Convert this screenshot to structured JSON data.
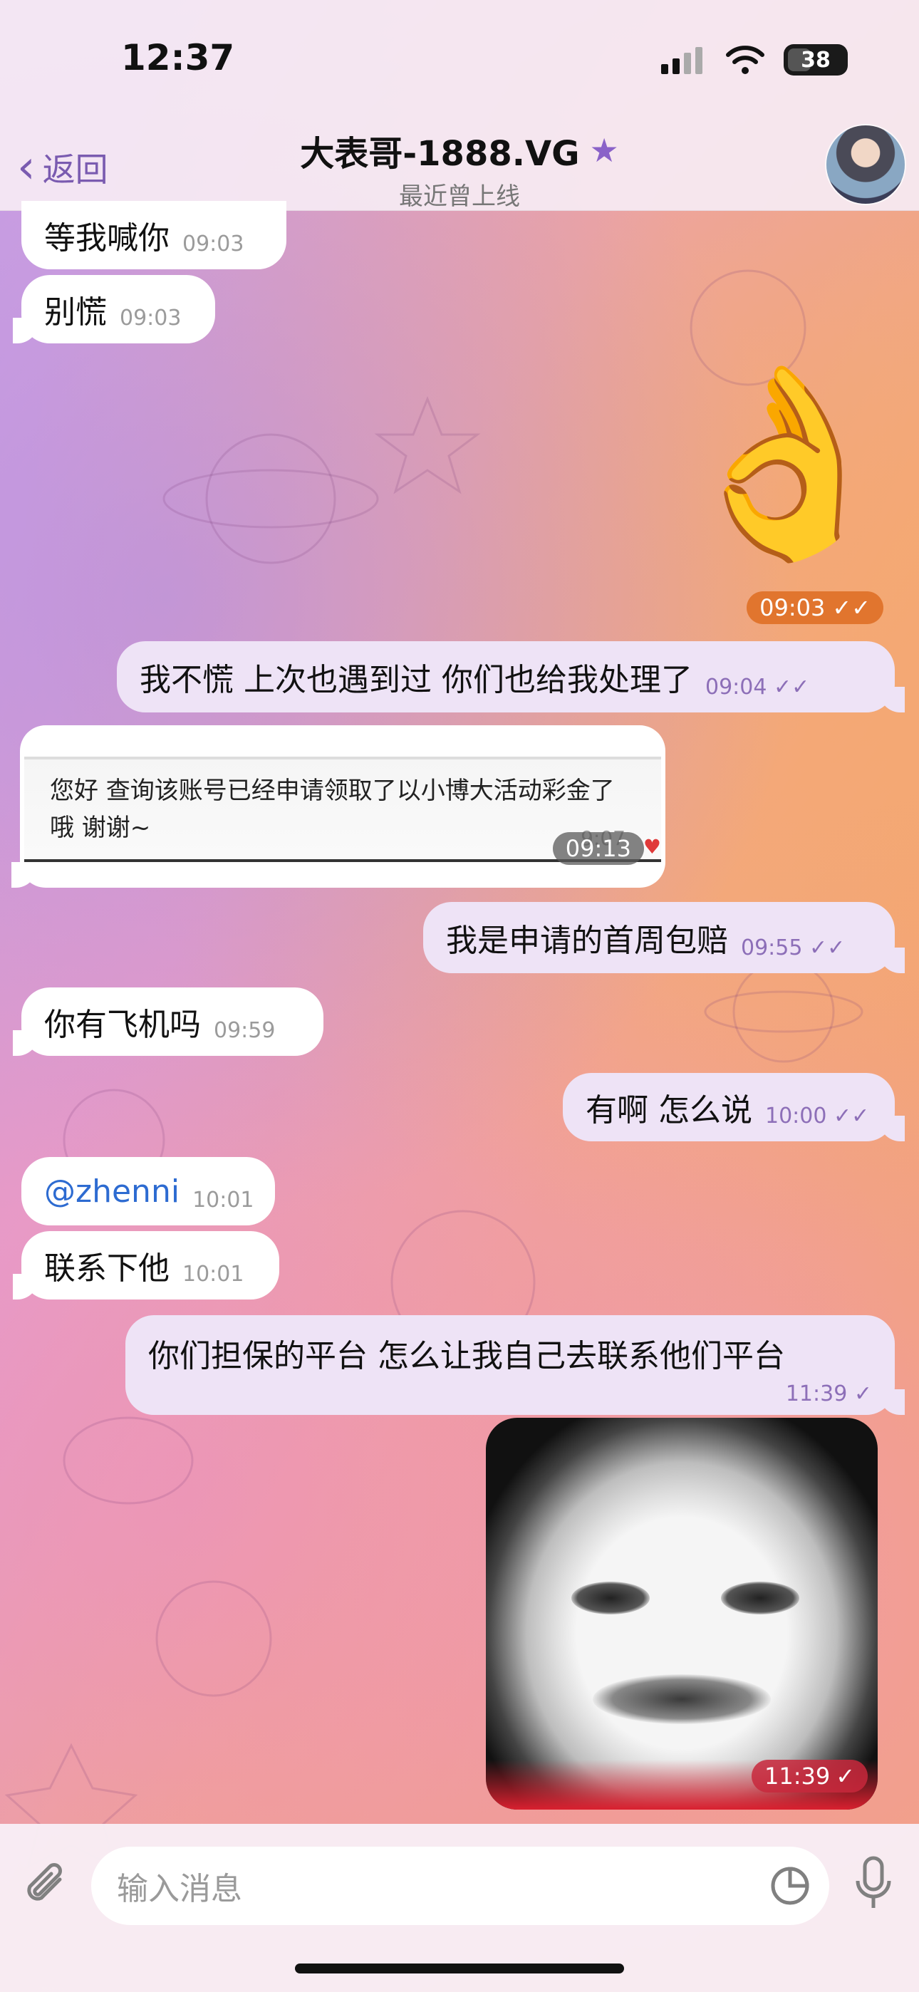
{
  "status_bar": {
    "time": "12:37",
    "battery": "38"
  },
  "header": {
    "back_label": "返回",
    "title": "大表哥-1888.VG",
    "subtitle": "最近曾上线"
  },
  "messages": [
    {
      "side": "incoming",
      "text": "等我喊你",
      "time": "09:03"
    },
    {
      "side": "incoming",
      "text": "别慌",
      "time": "09:03"
    },
    {
      "side": "outgoing",
      "type": "sticker",
      "emoji": "👌",
      "time": "09:03"
    },
    {
      "side": "outgoing",
      "text": "我不慌 上次也遇到过 你们也给我处理了",
      "time": "09:04"
    },
    {
      "side": "incoming",
      "type": "image",
      "image_text": "您好 查询该账号已经申请领取了以小博大活动彩金了哦 谢谢~",
      "image_time": "9:07",
      "time": "09:13"
    },
    {
      "side": "outgoing",
      "text": "我是申请的首周包赔",
      "time": "09:55"
    },
    {
      "side": "incoming",
      "text": "你有飞机吗",
      "time": "09:59"
    },
    {
      "side": "outgoing",
      "text": "有啊 怎么说",
      "time": "10:00"
    },
    {
      "side": "incoming",
      "text": "@zhenni",
      "time": "10:01"
    },
    {
      "side": "incoming",
      "text": "联系下他",
      "time": "10:01"
    },
    {
      "side": "outgoing",
      "text": "你们担保的平台 怎么让我自己去联系他们平台",
      "time": "11:39"
    },
    {
      "side": "outgoing",
      "type": "image",
      "time": "11:39"
    }
  ],
  "input": {
    "placeholder": "输入消息"
  },
  "colors": {
    "accent": "#7a5bb0",
    "outgoing_bubble": "#eee3f6",
    "incoming_bubble": "#ffffff"
  }
}
